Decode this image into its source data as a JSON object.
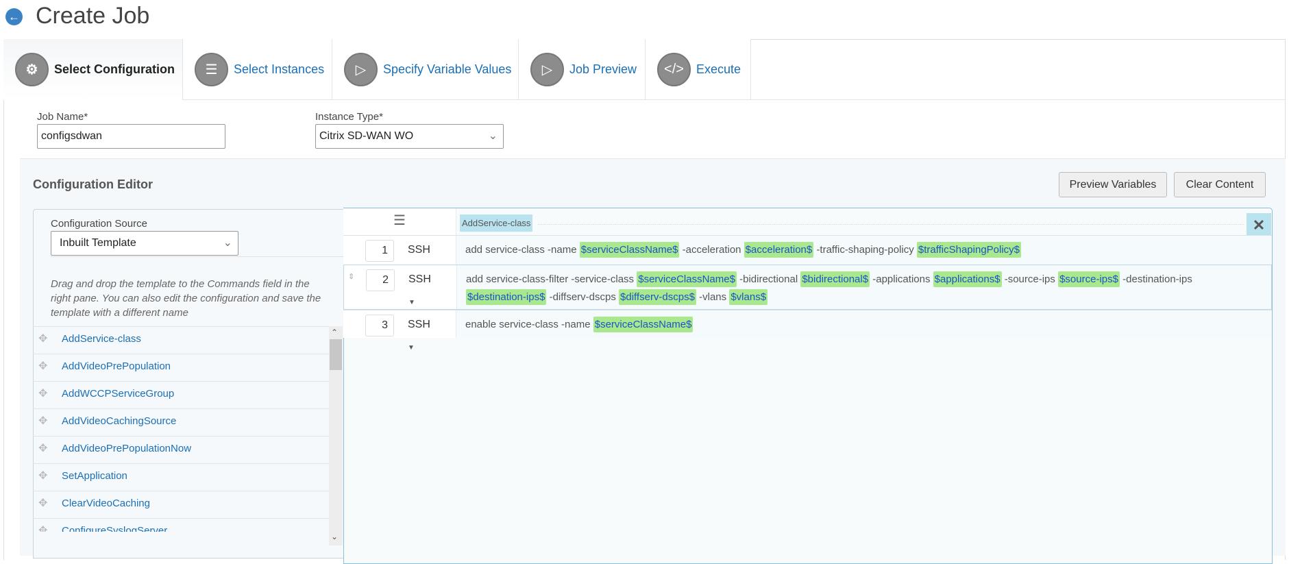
{
  "page": {
    "title": "Create Job",
    "back_icon": "arrow-left-circle-icon"
  },
  "tabs": [
    {
      "label": "Select Configuration",
      "icon": "gear-icon",
      "active": true
    },
    {
      "label": "Select Instances",
      "icon": "server-icon",
      "active": false
    },
    {
      "label": "Specify Variable Values",
      "icon": "chevron-right-box-icon",
      "active": false
    },
    {
      "label": "Job Preview",
      "icon": "chevron-right-box-icon",
      "active": false
    },
    {
      "label": "Execute",
      "icon": "code-icon",
      "active": false
    }
  ],
  "form": {
    "job_name_label": "Job Name*",
    "job_name_value": "configsdwan",
    "instance_type_label": "Instance Type*",
    "instance_type_value": "Citrix SD-WAN WO"
  },
  "editor": {
    "title": "Configuration Editor",
    "preview_button": "Preview Variables",
    "clear_button": "Clear Content",
    "source_label": "Configuration Source",
    "source_value": "Inbuilt Template",
    "help": "Drag and drop the template to the Commands field in the right pane. You can also edit the configuration and save the template with a different name",
    "templates": [
      "AddService-class",
      "AddVideoPrePopulation",
      "AddWCCPServiceGroup",
      "AddVideoCachingSource",
      "AddVideoPrePopulationNow",
      "SetApplication",
      "ClearVideoCaching",
      "ConfigureSyslogServer"
    ],
    "group_tag": "AddService-class",
    "commands": [
      {
        "num": "1",
        "protocol": "SSH",
        "parts": [
          [
            "t",
            "add service-class -name "
          ],
          [
            "v",
            "$serviceClassName$"
          ],
          [
            "t",
            " -acceleration "
          ],
          [
            "v",
            "$acceleration$"
          ],
          [
            "t",
            " -traffic-shaping-policy "
          ],
          [
            "v",
            "$trafficShapingPolicy$"
          ]
        ]
      },
      {
        "num": "2",
        "protocol": "SSH",
        "parts": [
          [
            "t",
            "add service-class-filter -service-class "
          ],
          [
            "v",
            "$serviceClassName$"
          ],
          [
            "t",
            " -bidirectional "
          ],
          [
            "v",
            "$bidirectional$"
          ],
          [
            "t",
            " -applications "
          ],
          [
            "v",
            "$applications$"
          ],
          [
            "t",
            " -source-ips "
          ],
          [
            "v",
            "$source-ips$"
          ],
          [
            "t",
            " -destination-ips "
          ],
          [
            "v",
            "$destination-ips$"
          ],
          [
            "t",
            " -diffserv-dscps "
          ],
          [
            "v",
            "$diffserv-dscps$"
          ],
          [
            "t",
            " -vlans "
          ],
          [
            "v",
            "$vlans$"
          ]
        ]
      },
      {
        "num": "3",
        "protocol": "SSH",
        "parts": [
          [
            "t",
            "enable service-class -name "
          ],
          [
            "v",
            "$serviceClassName$"
          ]
        ]
      }
    ]
  },
  "colors": {
    "accent": "#1a6fb5",
    "variable_bg": "#a9e88f",
    "tag_bg": "#b9e3ee"
  }
}
